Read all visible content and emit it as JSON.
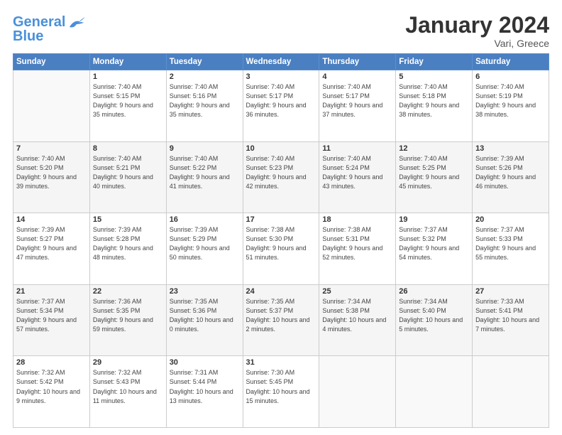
{
  "header": {
    "logo_line1": "General",
    "logo_line2": "Blue",
    "month": "January 2024",
    "location": "Vari, Greece"
  },
  "weekdays": [
    "Sunday",
    "Monday",
    "Tuesday",
    "Wednesday",
    "Thursday",
    "Friday",
    "Saturday"
  ],
  "weeks": [
    [
      {
        "day": "",
        "sunrise": "",
        "sunset": "",
        "daylight": ""
      },
      {
        "day": "1",
        "sunrise": "Sunrise: 7:40 AM",
        "sunset": "Sunset: 5:15 PM",
        "daylight": "Daylight: 9 hours and 35 minutes."
      },
      {
        "day": "2",
        "sunrise": "Sunrise: 7:40 AM",
        "sunset": "Sunset: 5:16 PM",
        "daylight": "Daylight: 9 hours and 35 minutes."
      },
      {
        "day": "3",
        "sunrise": "Sunrise: 7:40 AM",
        "sunset": "Sunset: 5:17 PM",
        "daylight": "Daylight: 9 hours and 36 minutes."
      },
      {
        "day": "4",
        "sunrise": "Sunrise: 7:40 AM",
        "sunset": "Sunset: 5:17 PM",
        "daylight": "Daylight: 9 hours and 37 minutes."
      },
      {
        "day": "5",
        "sunrise": "Sunrise: 7:40 AM",
        "sunset": "Sunset: 5:18 PM",
        "daylight": "Daylight: 9 hours and 38 minutes."
      },
      {
        "day": "6",
        "sunrise": "Sunrise: 7:40 AM",
        "sunset": "Sunset: 5:19 PM",
        "daylight": "Daylight: 9 hours and 38 minutes."
      }
    ],
    [
      {
        "day": "7",
        "sunrise": "Sunrise: 7:40 AM",
        "sunset": "Sunset: 5:20 PM",
        "daylight": "Daylight: 9 hours and 39 minutes."
      },
      {
        "day": "8",
        "sunrise": "Sunrise: 7:40 AM",
        "sunset": "Sunset: 5:21 PM",
        "daylight": "Daylight: 9 hours and 40 minutes."
      },
      {
        "day": "9",
        "sunrise": "Sunrise: 7:40 AM",
        "sunset": "Sunset: 5:22 PM",
        "daylight": "Daylight: 9 hours and 41 minutes."
      },
      {
        "day": "10",
        "sunrise": "Sunrise: 7:40 AM",
        "sunset": "Sunset: 5:23 PM",
        "daylight": "Daylight: 9 hours and 42 minutes."
      },
      {
        "day": "11",
        "sunrise": "Sunrise: 7:40 AM",
        "sunset": "Sunset: 5:24 PM",
        "daylight": "Daylight: 9 hours and 43 minutes."
      },
      {
        "day": "12",
        "sunrise": "Sunrise: 7:40 AM",
        "sunset": "Sunset: 5:25 PM",
        "daylight": "Daylight: 9 hours and 45 minutes."
      },
      {
        "day": "13",
        "sunrise": "Sunrise: 7:39 AM",
        "sunset": "Sunset: 5:26 PM",
        "daylight": "Daylight: 9 hours and 46 minutes."
      }
    ],
    [
      {
        "day": "14",
        "sunrise": "Sunrise: 7:39 AM",
        "sunset": "Sunset: 5:27 PM",
        "daylight": "Daylight: 9 hours and 47 minutes."
      },
      {
        "day": "15",
        "sunrise": "Sunrise: 7:39 AM",
        "sunset": "Sunset: 5:28 PM",
        "daylight": "Daylight: 9 hours and 48 minutes."
      },
      {
        "day": "16",
        "sunrise": "Sunrise: 7:39 AM",
        "sunset": "Sunset: 5:29 PM",
        "daylight": "Daylight: 9 hours and 50 minutes."
      },
      {
        "day": "17",
        "sunrise": "Sunrise: 7:38 AM",
        "sunset": "Sunset: 5:30 PM",
        "daylight": "Daylight: 9 hours and 51 minutes."
      },
      {
        "day": "18",
        "sunrise": "Sunrise: 7:38 AM",
        "sunset": "Sunset: 5:31 PM",
        "daylight": "Daylight: 9 hours and 52 minutes."
      },
      {
        "day": "19",
        "sunrise": "Sunrise: 7:37 AM",
        "sunset": "Sunset: 5:32 PM",
        "daylight": "Daylight: 9 hours and 54 minutes."
      },
      {
        "day": "20",
        "sunrise": "Sunrise: 7:37 AM",
        "sunset": "Sunset: 5:33 PM",
        "daylight": "Daylight: 9 hours and 55 minutes."
      }
    ],
    [
      {
        "day": "21",
        "sunrise": "Sunrise: 7:37 AM",
        "sunset": "Sunset: 5:34 PM",
        "daylight": "Daylight: 9 hours and 57 minutes."
      },
      {
        "day": "22",
        "sunrise": "Sunrise: 7:36 AM",
        "sunset": "Sunset: 5:35 PM",
        "daylight": "Daylight: 9 hours and 59 minutes."
      },
      {
        "day": "23",
        "sunrise": "Sunrise: 7:35 AM",
        "sunset": "Sunset: 5:36 PM",
        "daylight": "Daylight: 10 hours and 0 minutes."
      },
      {
        "day": "24",
        "sunrise": "Sunrise: 7:35 AM",
        "sunset": "Sunset: 5:37 PM",
        "daylight": "Daylight: 10 hours and 2 minutes."
      },
      {
        "day": "25",
        "sunrise": "Sunrise: 7:34 AM",
        "sunset": "Sunset: 5:38 PM",
        "daylight": "Daylight: 10 hours and 4 minutes."
      },
      {
        "day": "26",
        "sunrise": "Sunrise: 7:34 AM",
        "sunset": "Sunset: 5:40 PM",
        "daylight": "Daylight: 10 hours and 5 minutes."
      },
      {
        "day": "27",
        "sunrise": "Sunrise: 7:33 AM",
        "sunset": "Sunset: 5:41 PM",
        "daylight": "Daylight: 10 hours and 7 minutes."
      }
    ],
    [
      {
        "day": "28",
        "sunrise": "Sunrise: 7:32 AM",
        "sunset": "Sunset: 5:42 PM",
        "daylight": "Daylight: 10 hours and 9 minutes."
      },
      {
        "day": "29",
        "sunrise": "Sunrise: 7:32 AM",
        "sunset": "Sunset: 5:43 PM",
        "daylight": "Daylight: 10 hours and 11 minutes."
      },
      {
        "day": "30",
        "sunrise": "Sunrise: 7:31 AM",
        "sunset": "Sunset: 5:44 PM",
        "daylight": "Daylight: 10 hours and 13 minutes."
      },
      {
        "day": "31",
        "sunrise": "Sunrise: 7:30 AM",
        "sunset": "Sunset: 5:45 PM",
        "daylight": "Daylight: 10 hours and 15 minutes."
      },
      {
        "day": "",
        "sunrise": "",
        "sunset": "",
        "daylight": ""
      },
      {
        "day": "",
        "sunrise": "",
        "sunset": "",
        "daylight": ""
      },
      {
        "day": "",
        "sunrise": "",
        "sunset": "",
        "daylight": ""
      }
    ]
  ]
}
